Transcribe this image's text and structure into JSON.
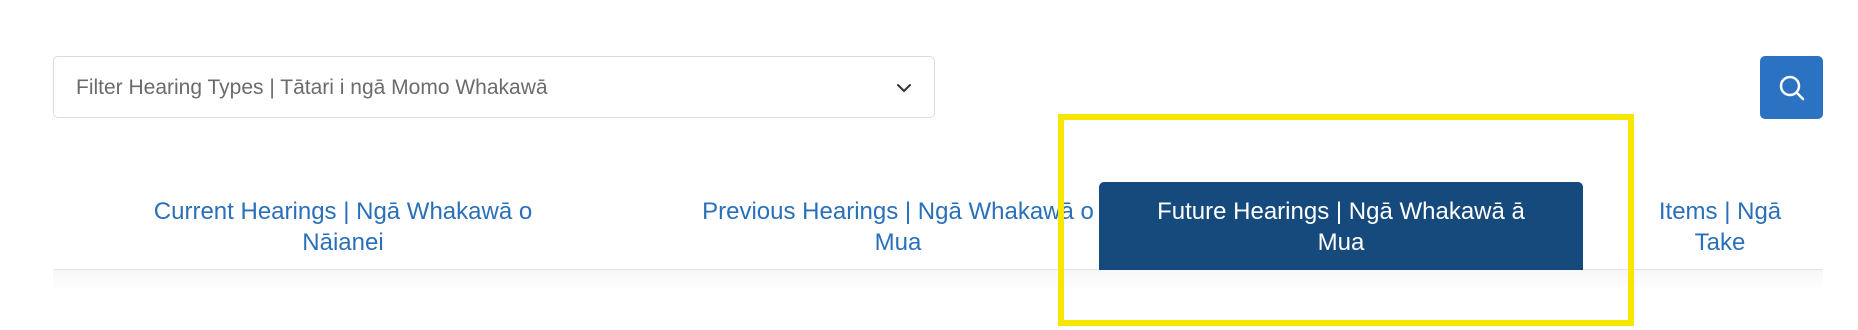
{
  "filter": {
    "placeholder": "Filter Hearing Types | Tātari i ngā Momo Whakawā",
    "icon": "chevron-down-icon"
  },
  "search": {
    "icon": "search-icon",
    "color": "#2b73c2"
  },
  "tabs": [
    {
      "label_line1": "Current Hearings | Ngā Whakawā o",
      "label_line2": "Nāianei",
      "active": false
    },
    {
      "label_line1": "Previous Hearings | Ngā Whakawā o",
      "label_line2": "Mua",
      "active": false
    },
    {
      "label_line1": "Future Hearings | Ngā Whakawā ā",
      "label_line2": "Mua",
      "active": true
    },
    {
      "label_line1": "Items | Ngā",
      "label_line2": "Take",
      "active": false
    }
  ],
  "colors": {
    "link": "#2a70b9",
    "active_tab_bg": "#174a7c",
    "highlight": "#f7e600"
  }
}
